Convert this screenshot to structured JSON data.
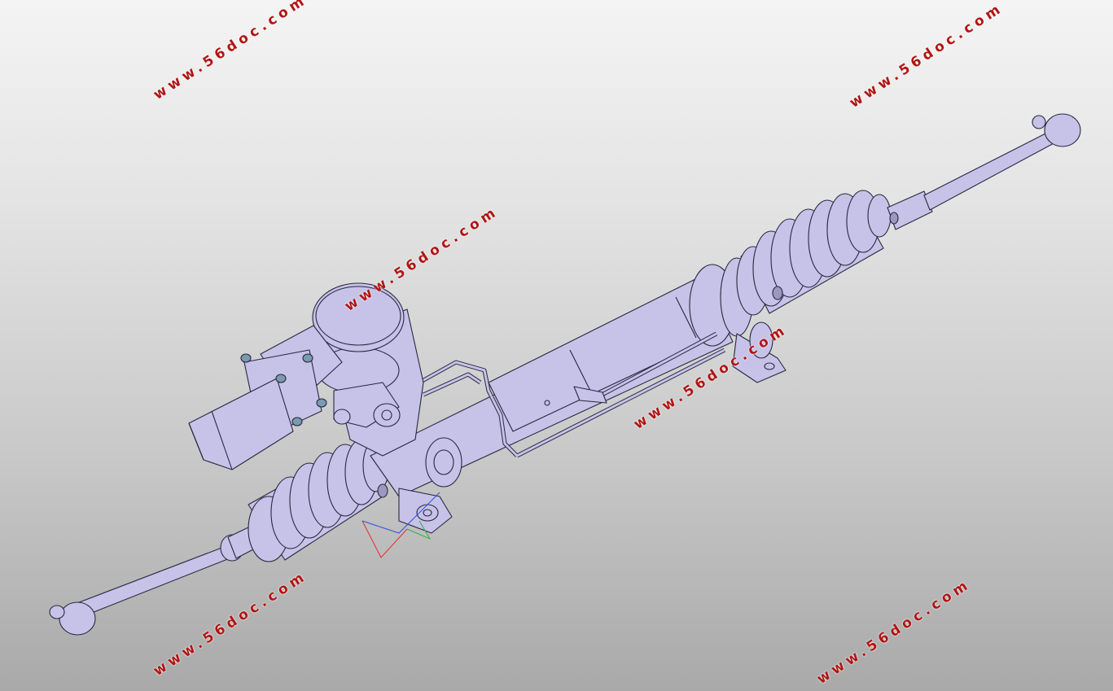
{
  "scene": {
    "background_top": "#f4f4f4",
    "background_bottom": "#a9a9a9",
    "part_color": "#c6c2e8",
    "part_edge_color": "#2a2840",
    "bolt_color": "#7a9ab0"
  },
  "watermarks": [
    "www.56doc.com",
    "www.56doc.com",
    "www.56doc.com",
    "www.56doc.com",
    "www.56doc.com",
    "www.56doc.com"
  ],
  "axis_triad": {
    "x_color": "#e03030",
    "y_color": "#30b040",
    "z_color": "#3050e0"
  }
}
